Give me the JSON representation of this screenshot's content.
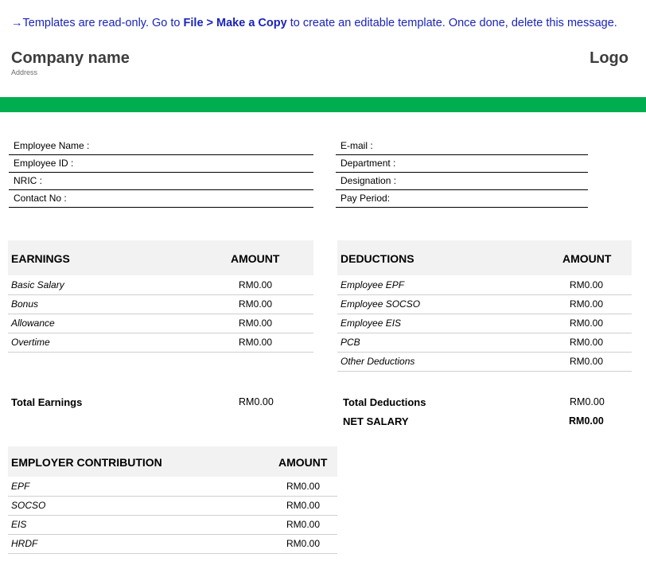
{
  "notice": {
    "arrow": "→",
    "pre": "Templates are read-only. Go to ",
    "bold": "File > Make a Copy",
    "post": " to create an editable template. Once done, delete this message."
  },
  "header": {
    "company": "Company name",
    "address": "Address",
    "logo": "Logo",
    "bar_color": "#00ad4f"
  },
  "employee_fields_left": [
    "Employee Name :",
    "Employee ID :",
    "NRIC :",
    "Contact No :"
  ],
  "employee_fields_right": [
    "E-mail :",
    "Department :",
    "Designation :",
    "Pay Period:"
  ],
  "earnings": {
    "title": "EARNINGS",
    "amount_header": "AMOUNT",
    "rows": [
      {
        "label": "Basic Salary",
        "amount": "RM0.00"
      },
      {
        "label": "Bonus",
        "amount": "RM0.00"
      },
      {
        "label": "Allowance",
        "amount": "RM0.00"
      },
      {
        "label": "Overtime",
        "amount": "RM0.00"
      }
    ],
    "total_label": "Total Earnings",
    "total_amount": "RM0.00"
  },
  "deductions": {
    "title": "DEDUCTIONS",
    "amount_header": "AMOUNT",
    "rows": [
      {
        "label": "Employee EPF",
        "amount": "RM0.00"
      },
      {
        "label": "Employee SOCSO",
        "amount": "RM0.00"
      },
      {
        "label": "Employee EIS",
        "amount": "RM0.00"
      },
      {
        "label": "PCB",
        "amount": "RM0.00"
      },
      {
        "label": "Other Deductions",
        "amount": "RM0.00"
      }
    ],
    "total_label": "Total Deductions",
    "total_amount": "RM0.00",
    "net_label": "NET SALARY",
    "net_amount": "RM0.00"
  },
  "employer": {
    "title": "EMPLOYER CONTRIBUTION",
    "amount_header": "AMOUNT",
    "rows": [
      {
        "label": "EPF",
        "amount": "RM0.00"
      },
      {
        "label": "SOCSO",
        "amount": "RM0.00"
      },
      {
        "label": "EIS",
        "amount": "RM0.00"
      },
      {
        "label": "HRDF",
        "amount": "RM0.00"
      }
    ]
  }
}
